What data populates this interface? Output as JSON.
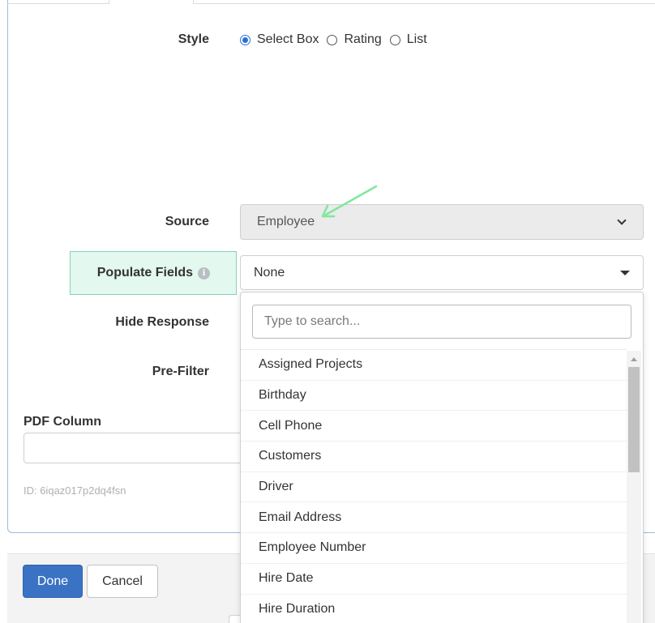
{
  "style_row": {
    "label": "Style",
    "options": [
      {
        "label": "Select Box",
        "checked": true
      },
      {
        "label": "Rating",
        "checked": false
      },
      {
        "label": "List",
        "checked": false
      }
    ]
  },
  "source_row": {
    "label": "Source",
    "value": "Employee"
  },
  "populate_row": {
    "label": "Populate Fields",
    "info_icon": "info-icon",
    "value": "None"
  },
  "hide_response_label": "Hide Response",
  "pre_filter_label": "Pre-Filter",
  "dropdown": {
    "search_placeholder": "Type to search...",
    "items": [
      "Assigned Projects",
      "Birthday",
      "Cell Phone",
      "Customers",
      "Driver",
      "Email Address",
      "Employee Number",
      "Hire Date",
      "Hire Duration"
    ]
  },
  "pdf_column": {
    "label": "PDF Column",
    "value": ""
  },
  "id_text": "ID: 6iqaz017p2dq4fsn",
  "footer": {
    "done_label": "Done",
    "cancel_label": "Cancel"
  },
  "colors": {
    "primary": "#3b73c4",
    "radio_selected": "#2a6fd6",
    "highlight_bg": "#e3f8ef",
    "highlight_border": "#86d3b4",
    "annotation_arrow": "#7ee89a"
  }
}
